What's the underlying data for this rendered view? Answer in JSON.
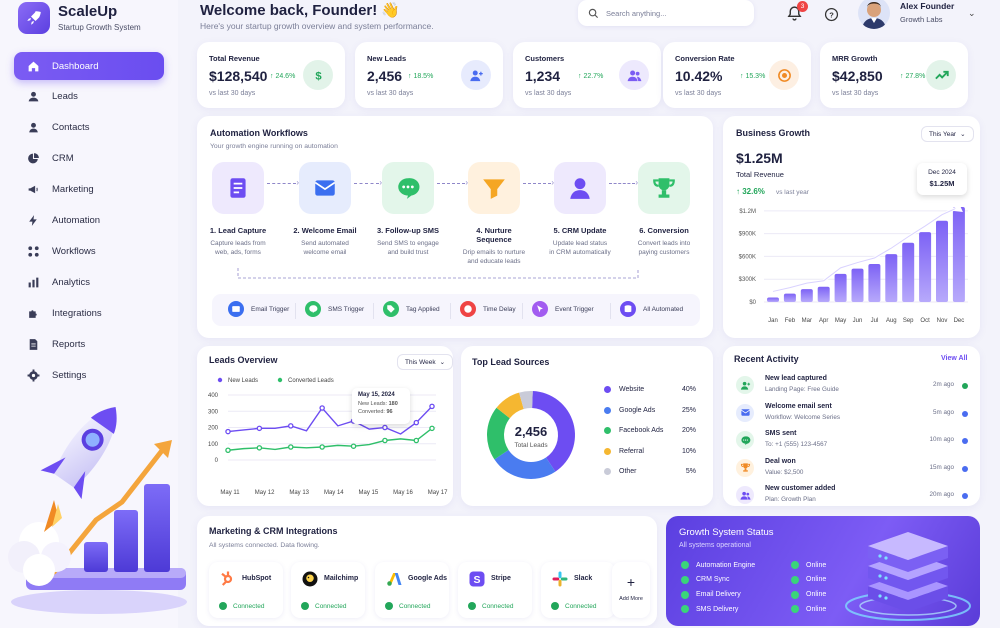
{
  "app": {
    "name": "ScaleUp",
    "tagline": "Startup Growth System"
  },
  "sidebar": {
    "items": [
      {
        "label": "Dashboard",
        "icon": "home-icon"
      },
      {
        "label": "Leads",
        "icon": "user-icon"
      },
      {
        "label": "Contacts",
        "icon": "contact-icon"
      },
      {
        "label": "CRM",
        "icon": "pie-icon"
      },
      {
        "label": "Marketing",
        "icon": "megaphone-icon"
      },
      {
        "label": "Automation",
        "icon": "bolt-icon"
      },
      {
        "label": "Workflows",
        "icon": "workflow-icon"
      },
      {
        "label": "Analytics",
        "icon": "bars-icon"
      },
      {
        "label": "Integrations",
        "icon": "puzzle-icon"
      },
      {
        "label": "Reports",
        "icon": "document-icon"
      },
      {
        "label": "Settings",
        "icon": "gear-icon"
      }
    ]
  },
  "header": {
    "title": "Welcome back, Founder! 👋",
    "subtitle": "Here's your startup growth overview and system performance.",
    "search_placeholder": "Search anything...",
    "notification_count": "3",
    "user": {
      "name": "Alex Founder",
      "company": "Growth Labs"
    }
  },
  "stats": [
    {
      "title": "Total Revenue",
      "value": "$128,540",
      "delta": "↑ 24.6%",
      "sub": "vs last 30 days",
      "icon": "dollar-icon",
      "color": "#22a65a"
    },
    {
      "title": "New Leads",
      "value": "2,456",
      "delta": "↑ 18.5%",
      "sub": "vs last 30 days",
      "icon": "add-user-icon",
      "color": "#4a6cf0"
    },
    {
      "title": "Customers",
      "value": "1,234",
      "delta": "↑ 22.7%",
      "sub": "vs last 30 days",
      "icon": "users-icon",
      "color": "#7b5cf3"
    },
    {
      "title": "Conversion Rate",
      "value": "10.42%",
      "delta": "↑ 15.3%",
      "sub": "vs last 30 days",
      "icon": "target-icon",
      "color": "#f08a24"
    },
    {
      "title": "MRR Growth",
      "value": "$42,850",
      "delta": "↑ 27.8%",
      "sub": "vs last 30 days",
      "icon": "trend-icon",
      "color": "#22a65a"
    }
  ],
  "automation": {
    "title": "Automation Workflows",
    "subtitle": "Your growth engine running on automation",
    "steps": [
      {
        "title": "1. Lead Capture",
        "desc1": "Capture leads from",
        "desc2": "web, ads, forms",
        "icon": "form-icon"
      },
      {
        "title": "2. Welcome Email",
        "desc1": "Send automated",
        "desc2": "welcome email",
        "icon": "email-icon"
      },
      {
        "title": "3. Follow-up SMS",
        "desc1": "Send SMS to engage",
        "desc2": "and build trust",
        "icon": "chat-icon"
      },
      {
        "title": "4. Nurture Sequence",
        "desc1": "Drip emails to nurture",
        "desc2": "and educate leads",
        "icon": "funnel-icon"
      },
      {
        "title": "5. CRM Update",
        "desc1": "Update lead status",
        "desc2": "in CRM automatically",
        "icon": "person-icon"
      },
      {
        "title": "6. Conversion",
        "desc1": "Convert leads into",
        "desc2": "paying customers",
        "icon": "trophy-icon"
      }
    ],
    "triggers": [
      "Email Trigger",
      "SMS Trigger",
      "Tag Applied",
      "Time Delay",
      "Event Trigger",
      "All Automated"
    ]
  },
  "business_growth": {
    "title": "Business Growth",
    "period": "This Year",
    "value": "$1.25M",
    "label": "Total Revenue",
    "delta": "↑ 32.6%",
    "delta_sub": "vs last year",
    "tooltip_month": "Dec 2024",
    "tooltip_value": "$1.25M"
  },
  "leads_overview": {
    "title": "Leads Overview",
    "period": "This Week",
    "tooltip_date": "May 15, 2024",
    "tooltip_new_label": "New Leads:",
    "tooltip_new_value": "180",
    "tooltip_conv_label": "Converted:",
    "tooltip_conv_value": "96"
  },
  "lead_sources": {
    "title": "Top Lead Sources",
    "total": "2,456",
    "total_label": "Total Leads",
    "items": [
      {
        "name": "Website",
        "pct": "40%",
        "color": "#6d4df2"
      },
      {
        "name": "Google Ads",
        "pct": "25%",
        "color": "#4a7cf0"
      },
      {
        "name": "Facebook Ads",
        "pct": "20%",
        "color": "#2fbf6a"
      },
      {
        "name": "Referral",
        "pct": "10%",
        "color": "#f5b731"
      },
      {
        "name": "Other",
        "pct": "5%",
        "color": "#c9cbd8"
      }
    ]
  },
  "activity": {
    "title": "Recent Activity",
    "view_all": "View All",
    "items": [
      {
        "title": "New lead captured",
        "sub": "Landing Page: Free Guide",
        "time": "2m ago",
        "icon": "add-user-icon",
        "bg": "#e3f6ea",
        "fg": "#22a65a",
        "dot": "#22a65a"
      },
      {
        "title": "Welcome email sent",
        "sub": "Workflow: Welcome Series",
        "time": "5m ago",
        "icon": "email-icon",
        "bg": "#e6ecfd",
        "fg": "#4a6cf0",
        "dot": "#4a6cf0"
      },
      {
        "title": "SMS sent",
        "sub": "To: +1 (555) 123-4567",
        "time": "10m ago",
        "icon": "chat-icon",
        "bg": "#e3f6ea",
        "fg": "#22a65a",
        "dot": "#4a6cf0"
      },
      {
        "title": "Deal won",
        "sub": "Value: $2,500",
        "time": "15m ago",
        "icon": "trophy-icon",
        "bg": "#fff1de",
        "fg": "#f08a24",
        "dot": "#4a6cf0"
      },
      {
        "title": "New customer added",
        "sub": "Plan: Growth Plan",
        "time": "20m ago",
        "icon": "users-icon",
        "bg": "#eee9fd",
        "fg": "#6d4df2",
        "dot": "#4a6cf0"
      }
    ]
  },
  "integrations": {
    "title": "Marketing & CRM Integrations",
    "subtitle": "All systems connected. Data flowing.",
    "items": [
      {
        "name": "HubSpot",
        "status": "Connected",
        "icon": "hubspot-icon"
      },
      {
        "name": "Mailchimp",
        "status": "Connected",
        "icon": "mailchimp-icon"
      },
      {
        "name": "Google Ads",
        "status": "Connected",
        "icon": "google-ads-icon"
      },
      {
        "name": "Stripe",
        "status": "Connected",
        "icon": "stripe-icon"
      },
      {
        "name": "Slack",
        "status": "Connected",
        "icon": "slack-icon"
      }
    ],
    "add_more": "Add More"
  },
  "growth_status": {
    "title": "Growth System Status",
    "subtitle": "All systems operational",
    "rows": [
      {
        "name": "Automation Engine",
        "status": "Online"
      },
      {
        "name": "CRM Sync",
        "status": "Online"
      },
      {
        "name": "Email Delivery",
        "status": "Online"
      },
      {
        "name": "SMS Delivery",
        "status": "Online"
      }
    ]
  },
  "chart_data": [
    {
      "type": "bar",
      "title": "Business Growth",
      "categories": [
        "Jan",
        "Feb",
        "Mar",
        "Apr",
        "May",
        "Jun",
        "Jul",
        "Aug",
        "Sep",
        "Oct",
        "Nov",
        "Dec"
      ],
      "series": [
        {
          "values": [
            0.06,
            0.11,
            0.17,
            0.2,
            0.37,
            0.44,
            0.5,
            0.63,
            0.78,
            0.92,
            1.07,
            1.25
          ]
        }
      ],
      "yticks": [
        "$0",
        "$300K",
        "$600K",
        "$900K",
        "$1.2M"
      ],
      "ylim": [
        0,
        1.2
      ],
      "unit": "$M"
    },
    {
      "type": "line",
      "title": "Leads Overview",
      "categories": [
        "May 11",
        "May 12",
        "May 13",
        "May 14",
        "May 15",
        "May 16",
        "May 17"
      ],
      "series": [
        {
          "name": "New Leads",
          "color": "#6d4df2",
          "values": [
            175,
            185,
            195,
            195,
            210,
            180,
            320,
            210,
            240,
            190,
            200,
            160,
            230,
            330
          ]
        },
        {
          "name": "Converted Leads",
          "color": "#2fbf6a",
          "values": [
            60,
            70,
            75,
            65,
            80,
            75,
            80,
            90,
            85,
            95,
            120,
            130,
            120,
            195
          ]
        }
      ],
      "yticks": [
        "0",
        "100",
        "200",
        "300",
        "400"
      ],
      "ylim": [
        0,
        400
      ],
      "grid": true
    },
    {
      "type": "pie",
      "title": "Top Lead Sources",
      "categories": [
        "Website",
        "Google Ads",
        "Facebook Ads",
        "Referral",
        "Other"
      ],
      "values": [
        40,
        25,
        20,
        10,
        5
      ]
    }
  ]
}
